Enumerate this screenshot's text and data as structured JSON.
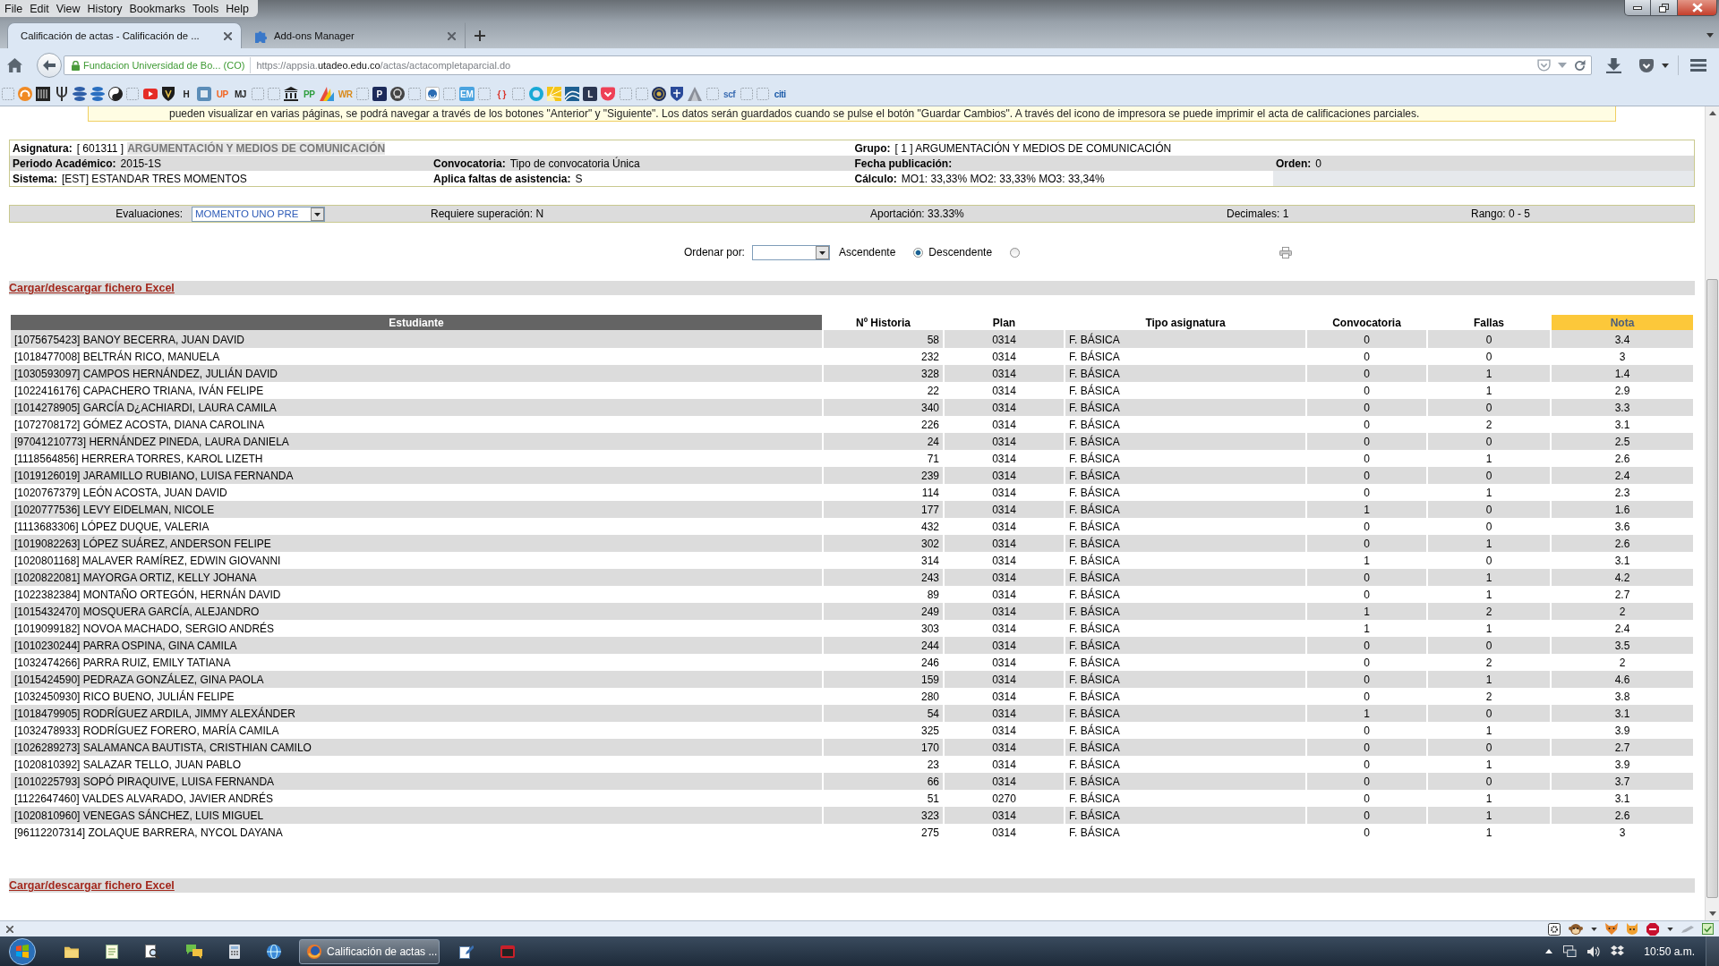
{
  "browser": {
    "menu": [
      "File",
      "Edit",
      "View",
      "History",
      "Bookmarks",
      "Tools",
      "Help"
    ],
    "tabs": [
      {
        "title": "Calificación de actas - Calificación de ...",
        "selected": true
      },
      {
        "title": "Add-ons Manager",
        "selected": false,
        "favicon": true
      }
    ],
    "site_identity": "Fundacion Universidad de Bo... (CO)",
    "url": {
      "prefix": "https://appsia.",
      "host": "utadeo.edu.co",
      "path": "/actas/actacompletaparcial.do"
    },
    "bookmarks": [
      {
        "kind": "placeholder"
      },
      {
        "kind": "favicon"
      },
      {
        "kind": "favicon"
      },
      {
        "kind": "favicon"
      },
      {
        "kind": "favicon"
      },
      {
        "kind": "favicon"
      },
      {
        "kind": "favicon"
      },
      {
        "kind": "placeholder"
      },
      {
        "kind": "favicon"
      },
      {
        "kind": "favicon"
      },
      {
        "kind": "lettered",
        "label": "H",
        "color": "#222222"
      },
      {
        "kind": "favicon"
      },
      {
        "kind": "lettered",
        "label": "UP",
        "color": "#f26522"
      },
      {
        "kind": "lettered",
        "label": "MJ",
        "color": "#222222"
      },
      {
        "kind": "placeholder"
      },
      {
        "kind": "placeholder"
      },
      {
        "kind": "favicon"
      },
      {
        "kind": "lettered",
        "label": "PP",
        "color": "#2e9e3e"
      },
      {
        "kind": "favicon"
      },
      {
        "kind": "lettered",
        "label": "WR",
        "color": "#d98a1b"
      },
      {
        "kind": "placeholder"
      },
      {
        "kind": "tile",
        "label": "P",
        "color": "#1c2a5a"
      },
      {
        "kind": "favicon"
      },
      {
        "kind": "placeholder"
      },
      {
        "kind": "favicon"
      },
      {
        "kind": "placeholder"
      },
      {
        "kind": "tile",
        "label": "EM",
        "color": "#4aa3df"
      },
      {
        "kind": "placeholder"
      },
      {
        "kind": "lettered",
        "label": "{ }",
        "color": "#d9342b"
      },
      {
        "kind": "placeholder"
      },
      {
        "kind": "favicon"
      },
      {
        "kind": "favicon"
      },
      {
        "kind": "favicon"
      },
      {
        "kind": "tile",
        "label": "L",
        "color": "#2a3550"
      },
      {
        "kind": "favicon"
      },
      {
        "kind": "placeholder"
      },
      {
        "kind": "placeholder"
      },
      {
        "kind": "favicon"
      },
      {
        "kind": "favicon"
      },
      {
        "kind": "favicon"
      },
      {
        "kind": "placeholder"
      },
      {
        "kind": "lettered",
        "label": "scf",
        "color": "#3b6db3"
      },
      {
        "kind": "placeholder"
      },
      {
        "kind": "placeholder"
      },
      {
        "kind": "lettered",
        "label": "citi",
        "color": "#1a5aa8"
      }
    ]
  },
  "notice": "pueden visualizar en varias páginas, se podrá navegar a través de los botones \"Anterior\" y \"Siguiente\". Los datos serán guardados cuando se pulse el botón \"Guardar Cambios\". A través del icono de impresora se puede imprimir el acta de calificaciones parciales.",
  "course_info": {
    "rows": [
      [
        {
          "label": "Asignatura:",
          "value": "[ 601311 ]",
          "name": "ARGUMENTACIÓN Y MEDIOS DE COMUNICACIÓN",
          "colspan": 2
        },
        {
          "label": "Grupo:",
          "value": "[ 1 ] ARGUMENTACIÓN Y MEDIOS DE COMUNICACIÓN",
          "colspan": 2
        }
      ],
      [
        {
          "label": "Periodo Académico:",
          "value": "2015-1S"
        },
        {
          "label": "Convocatoria:",
          "value": "Tipo de convocatoria Única"
        },
        {
          "label": "Fecha publicación:"
        },
        {
          "label": "Orden:",
          "value": "0"
        }
      ],
      [
        {
          "label": "Sistema:",
          "value": "[EST] ESTANDAR TRES MOMENTOS"
        },
        {
          "label": "Aplica faltas de asistencia:",
          "value": "S"
        },
        {
          "label": "Cálculo:",
          "value": "MO1: 33,33% MO2: 33,33% MO3: 33,34%"
        }
      ]
    ]
  },
  "evaluation_bar": {
    "label": "Evaluaciones:",
    "selected_evaluation": "MOMENTO UNO PRE",
    "details": [
      "Requiere superación: N",
      "Aportación: 33.33%",
      "Decimales: 1",
      "Rango: 0 - 5"
    ]
  },
  "sort": {
    "label": "Ordenar por:",
    "options": [
      {
        "label": "Ascendente",
        "selected": true
      },
      {
        "label": "Descendente",
        "selected": false
      }
    ]
  },
  "excel_link_top": "Cargar/descargar fichero Excel",
  "grades_table": {
    "columns": [
      {
        "label": "Estudiante",
        "kind": "key"
      },
      {
        "label": "Nº Historia",
        "kind": "plain"
      },
      {
        "label": "Plan",
        "kind": "plain"
      },
      {
        "label": "Tipo asignatura",
        "kind": "plain"
      },
      {
        "label": "Convocatoria",
        "kind": "plain"
      },
      {
        "label": "Fallas",
        "kind": "plain"
      },
      {
        "label": "Nota",
        "kind": "grade"
      }
    ],
    "rows": [
      [
        "[1075675423] BANOY BECERRA, JUAN DAVID",
        "58",
        "0314",
        "F. BÁSICA",
        "0",
        "0",
        "3.4"
      ],
      [
        "[1018477008] BELTRÁN RICO, MANUELA",
        "232",
        "0314",
        "F. BÁSICA",
        "0",
        "0",
        "3"
      ],
      [
        "[1030593097] CAMPOS HERNÁNDEZ, JULIÁN DAVID",
        "328",
        "0314",
        "F. BÁSICA",
        "0",
        "1",
        "1.4"
      ],
      [
        "[1022416176] CAPACHERO TRIANA, IVÁN FELIPE",
        "22",
        "0314",
        "F. BÁSICA",
        "0",
        "1",
        "2.9"
      ],
      [
        "[1014278905] GARCÍA D¿ACHIARDI, LAURA CAMILA",
        "340",
        "0314",
        "F. BÁSICA",
        "0",
        "0",
        "3.3"
      ],
      [
        "[1072708172] GÓMEZ ACOSTA, DIANA CAROLINA",
        "226",
        "0314",
        "F. BÁSICA",
        "0",
        "2",
        "3.1"
      ],
      [
        "[97041210773] HERNÁNDEZ PINEDA, LAURA DANIELA",
        "24",
        "0314",
        "F. BÁSICA",
        "0",
        "0",
        "2.5"
      ],
      [
        "[1118564856] HERRERA TORRES, KAROL LIZETH",
        "71",
        "0314",
        "F. BÁSICA",
        "0",
        "1",
        "2.6"
      ],
      [
        "[1019126019] JARAMILLO RUBIANO, LUISA FERNANDA",
        "239",
        "0314",
        "F. BÁSICA",
        "0",
        "0",
        "2.4"
      ],
      [
        "[1020767379] LEÓN ACOSTA, JUAN DAVID",
        "114",
        "0314",
        "F. BÁSICA",
        "0",
        "1",
        "2.3"
      ],
      [
        "[1020777536] LEVY EIDELMAN, NICOLE",
        "177",
        "0314",
        "F. BÁSICA",
        "1",
        "0",
        "1.6"
      ],
      [
        "[1113683306] LÓPEZ DUQUE, VALERIA",
        "432",
        "0314",
        "F. BÁSICA",
        "0",
        "0",
        "3.6"
      ],
      [
        "[1019082263] LÓPEZ SUÁREZ, ANDERSON FELIPE",
        "302",
        "0314",
        "F. BÁSICA",
        "0",
        "1",
        "2.6"
      ],
      [
        "[1020801168] MALAVER RAMÍREZ, EDWIN GIOVANNI",
        "314",
        "0314",
        "F. BÁSICA",
        "1",
        "0",
        "3.1"
      ],
      [
        "[1020822081] MAYORGA ORTIZ, KELLY JOHANA",
        "243",
        "0314",
        "F. BÁSICA",
        "0",
        "1",
        "4.2"
      ],
      [
        "[1022382384] MONTAÑO ORTEGÓN, HERNÁN DAVID",
        "89",
        "0314",
        "F. BÁSICA",
        "0",
        "1",
        "2.7"
      ],
      [
        "[1015432470] MOSQUERA GARCÍA, ALEJANDRO",
        "249",
        "0314",
        "F. BÁSICA",
        "1",
        "2",
        "2"
      ],
      [
        "[1019099182] NOVOA MACHADO, SERGIO ANDRÉS",
        "303",
        "0314",
        "F. BÁSICA",
        "1",
        "1",
        "2.4"
      ],
      [
        "[1010230244] PARRA OSPINA, GINA CAMILA",
        "244",
        "0314",
        "F. BÁSICA",
        "0",
        "0",
        "3.5"
      ],
      [
        "[1032474266] PARRA RUIZ, EMILY TATIANA",
        "246",
        "0314",
        "F. BÁSICA",
        "0",
        "2",
        "2"
      ],
      [
        "[1015424590] PEDRAZA GONZÁLEZ, GINA PAOLA",
        "159",
        "0314",
        "F. BÁSICA",
        "0",
        "1",
        "4.6"
      ],
      [
        "[1032450930] RICO BUENO, JULIÁN FELIPE",
        "280",
        "0314",
        "F. BÁSICA",
        "0",
        "2",
        "3.8"
      ],
      [
        "[1018479905] RODRÍGUEZ ARDILA, JIMMY ALEXÁNDER",
        "54",
        "0314",
        "F. BÁSICA",
        "1",
        "0",
        "3.1"
      ],
      [
        "[1032478933] RODRÍGUEZ FORERO, MARÍA CAMILA",
        "325",
        "0314",
        "F. BÁSICA",
        "0",
        "1",
        "3.9"
      ],
      [
        "[1026289273] SALAMANCA BAUTISTA, CRISTHIAN CAMILO",
        "170",
        "0314",
        "F. BÁSICA",
        "0",
        "0",
        "2.7"
      ],
      [
        "[1020810392] SALAZAR TELLO, JUAN PABLO",
        "23",
        "0314",
        "F. BÁSICA",
        "0",
        "1",
        "3.9"
      ],
      [
        "[1010225793] SOPÓ PIRAQUIVE, LUISA FERNANDA",
        "66",
        "0314",
        "F. BÁSICA",
        "0",
        "0",
        "3.7"
      ],
      [
        "[1122647460] VALDES ALVARADO, JAVIER ANDRÉS",
        "51",
        "0270",
        "F. BÁSICA",
        "0",
        "1",
        "3.1"
      ],
      [
        "[1020810960] VENEGAS SÁNCHEZ, LUIS MIGUEL",
        "323",
        "0314",
        "F. BÁSICA",
        "0",
        "1",
        "2.6"
      ],
      [
        "[96112207314] ZOLAQUE BARRERA, NYCOL DAYANA",
        "275",
        "0314",
        "F. BÁSICA",
        "0",
        "1",
        "3"
      ]
    ]
  },
  "excel_link_bottom": "Cargar/descargar fichero Excel",
  "taskbar": {
    "active_window": "Calificación de actas ...",
    "clock": "10:50 a.m."
  }
}
